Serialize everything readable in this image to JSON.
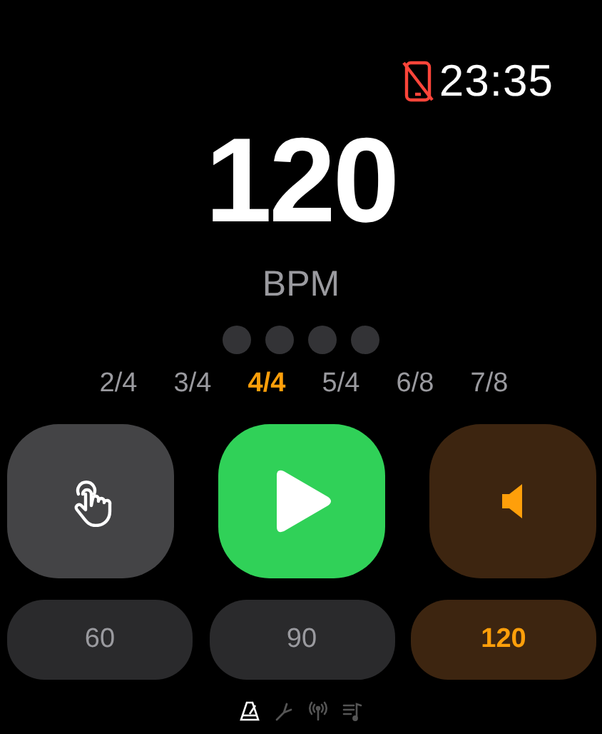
{
  "status_bar": {
    "phone_disconnected": true,
    "time": "23:35"
  },
  "tempo": {
    "value": "120",
    "unit": "BPM"
  },
  "beats": [
    {
      "active": false
    },
    {
      "active": false
    },
    {
      "active": false
    },
    {
      "active": false
    }
  ],
  "time_signatures": [
    {
      "label": "2/4",
      "selected": false
    },
    {
      "label": "3/4",
      "selected": false
    },
    {
      "label": "4/4",
      "selected": true
    },
    {
      "label": "5/4",
      "selected": false
    },
    {
      "label": "6/8",
      "selected": false
    },
    {
      "label": "7/8",
      "selected": false
    }
  ],
  "controls": [
    {
      "kind": "tap"
    },
    {
      "kind": "play"
    },
    {
      "kind": "sound"
    }
  ],
  "presets": [
    {
      "label": "60",
      "selected": false
    },
    {
      "label": "90",
      "selected": false
    },
    {
      "label": "120",
      "selected": true
    }
  ],
  "pages": [
    {
      "kind": "metronome",
      "selected": true
    },
    {
      "kind": "tuner",
      "selected": false
    },
    {
      "kind": "signal",
      "selected": false
    },
    {
      "kind": "playlist",
      "selected": false
    }
  ]
}
